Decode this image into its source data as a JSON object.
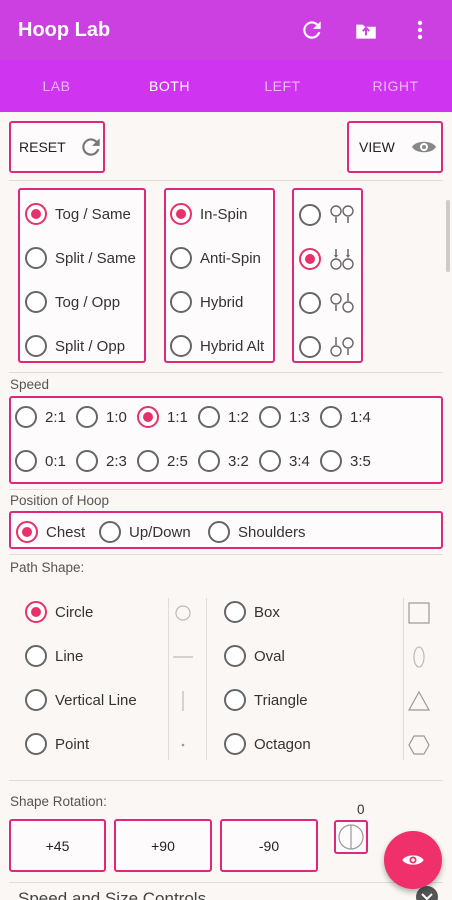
{
  "app": {
    "title": "Hoop Lab",
    "actions": [
      "refresh-icon",
      "export-icon",
      "more-vert-icon"
    ]
  },
  "tabs": [
    {
      "label": "LAB",
      "active": false
    },
    {
      "label": "BOTH",
      "active": true
    },
    {
      "label": "LEFT",
      "active": false
    },
    {
      "label": "RIGHT",
      "active": false
    }
  ],
  "top_buttons": {
    "reset": "RESET",
    "view": "VIEW"
  },
  "mode_group": {
    "options": [
      "Tog / Same",
      "Split / Same",
      "Tog / Opp",
      "Split / Opp"
    ],
    "selected": 0
  },
  "spin_group": {
    "options": [
      "In-Spin",
      "Anti-Spin",
      "Hybrid",
      "Hybrid Alt"
    ],
    "selected": 0
  },
  "orient_group": {
    "selected": 1
  },
  "speed": {
    "label": "Speed",
    "row1": [
      "2:1",
      "1:0",
      "1:1",
      "1:2",
      "1:3",
      "1:4"
    ],
    "row2": [
      "0:1",
      "2:3",
      "2:5",
      "3:2",
      "3:4",
      "3:5"
    ],
    "selected": "1:1"
  },
  "position": {
    "label": "Position of Hoop",
    "options": [
      "Chest",
      "Up/Down",
      "Shoulders"
    ],
    "selected": 0
  },
  "path_shape": {
    "label": "Path Shape:",
    "left": [
      "Circle",
      "Line",
      "Vertical Line",
      "Point"
    ],
    "right": [
      "Box",
      "Oval",
      "Triangle",
      "Octagon"
    ],
    "selected": "Circle"
  },
  "rotation": {
    "label": "Shape Rotation:",
    "buttons": [
      "+45",
      "+90",
      "-90"
    ],
    "value": "0"
  },
  "footer": {
    "label": "Speed and Size Controls"
  },
  "colors": {
    "accent": "#e8306a",
    "appbar": "#cc3fe0",
    "tabs": "#cf35f0"
  }
}
